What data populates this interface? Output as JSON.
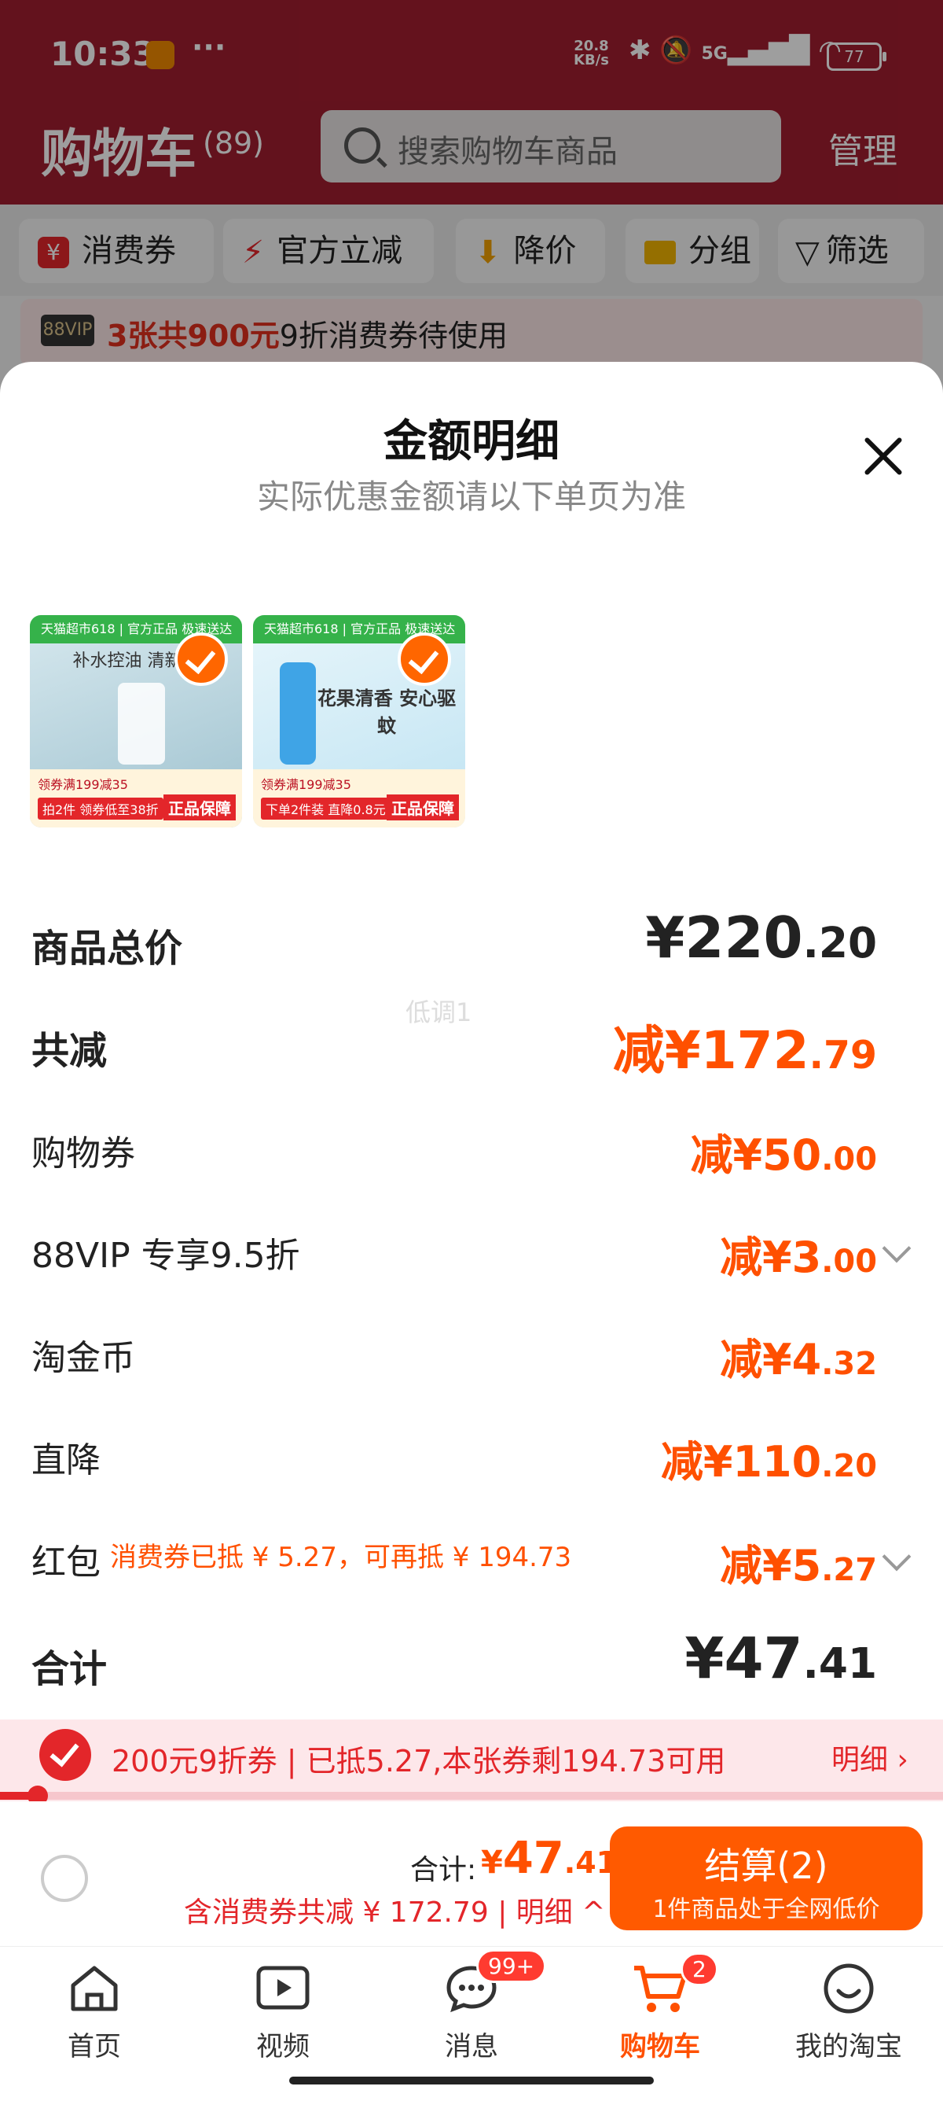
{
  "status_bar": {
    "time": "10:33",
    "net_speed": "20.8",
    "net_unit": "KB/s",
    "signal": "5G",
    "battery": "77"
  },
  "header": {
    "title": "购物车",
    "count": "(89)",
    "search_placeholder": "搜索购物车商品",
    "manage": "管理"
  },
  "filter_chips": [
    {
      "label": "消费券",
      "icon": "coupon-icon"
    },
    {
      "label": "官方立减",
      "icon": "lightning-icon"
    },
    {
      "label": "降价",
      "icon": "price-drop-icon"
    },
    {
      "label": "分组",
      "icon": "folder-icon"
    },
    {
      "label": "筛选",
      "icon": "filter-icon"
    }
  ],
  "vip_banner": {
    "badge": "88VIP",
    "highlight": "3张共900元",
    "text": "9折消费券待使用"
  },
  "sheet": {
    "title": "金额明细",
    "subtitle": "实际优惠金额请以下单页为准",
    "watermark": "低调1",
    "products": [
      {
        "header": "天猫超市618 | 官方正品 极速送达",
        "caption": "补水控油 清新水",
        "promo1": "领券满199减35",
        "promo2": "拍2件 领券低至38折",
        "promo3": "正品保障"
      },
      {
        "header": "天猫超市618 | 官方正品 极速送达",
        "caption": "花果清香 安心驱蚊",
        "promo1": "领券满199减35",
        "promo2": "下单2件装 直降0.8元",
        "promo3": "正品保障"
      }
    ],
    "rows": [
      {
        "label": "商品总价",
        "prefix": "¥",
        "int": "220",
        "dec": ".20",
        "color": "#222222"
      },
      {
        "label": "共减",
        "prefix": "减¥",
        "int": "172",
        "dec": ".79",
        "color": "#ff5000"
      },
      {
        "label": "购物券",
        "prefix": "减¥",
        "int": "50",
        "dec": ".00",
        "color": "#ff5000"
      },
      {
        "label": "88VIP 专享9.5折",
        "prefix": "减¥",
        "int": "3",
        "dec": ".00",
        "color": "#ff5000"
      },
      {
        "label": "淘金币",
        "prefix": "减¥",
        "int": "4",
        "dec": ".32",
        "color": "#ff5000"
      },
      {
        "label": "直降",
        "prefix": "减¥",
        "int": "110",
        "dec": ".20",
        "color": "#ff5000"
      },
      {
        "label": "红包",
        "prefix": "减¥",
        "int": "5",
        "dec": ".27",
        "color": "#ff5000"
      },
      {
        "label": "合计",
        "prefix": "¥",
        "int": "47",
        "dec": ".41",
        "color": "#222222"
      }
    ],
    "hongbao_note": "消费券已抵 ¥ 5.27，可再抵 ¥ 194.73"
  },
  "coupon_bar": {
    "text": "200元9折券 | 已抵5.27,本张券剩194.73可用",
    "detail": "明细 ›",
    "progress": 0.04
  },
  "checkout": {
    "total_label": "合计:",
    "total_prefix": "¥",
    "total_int": "47",
    "total_dec": ".41",
    "saved": "含消费券共减 ¥ 172.79 | 明细 ^",
    "button": "结算(2)",
    "button_sub": "1件商品处于全网低价"
  },
  "tabs": [
    {
      "label": "首页",
      "icon": "home-icon"
    },
    {
      "label": "视频",
      "icon": "video-icon"
    },
    {
      "label": "消息",
      "icon": "message-icon",
      "badge": "99+"
    },
    {
      "label": "购物车",
      "icon": "cart-icon",
      "badge": "2",
      "active": true
    },
    {
      "label": "我的淘宝",
      "icon": "profile-icon"
    }
  ]
}
